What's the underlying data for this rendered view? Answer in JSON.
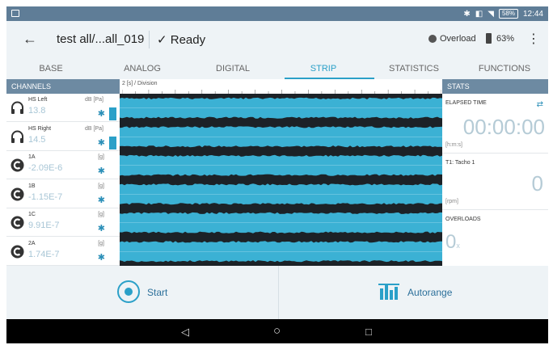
{
  "status_bar": {
    "battery_badge": "58%",
    "time": "12:44",
    "bluetooth_icon": "bluetooth-icon",
    "vibrate_icon": "vibrate-icon",
    "wifi_icon": "wifi-icon"
  },
  "app_bar": {
    "back_icon": "arrow-left-icon",
    "title": "test all/...all_019",
    "status_check": "✓",
    "status": "Ready",
    "overload_label": "Overload",
    "battery_pct": "63%",
    "menu_icon": "more-vert-icon"
  },
  "tabs": [
    {
      "label": "BASE"
    },
    {
      "label": "ANALOG"
    },
    {
      "label": "DIGITAL"
    },
    {
      "label": "STRIP"
    },
    {
      "label": "STATISTICS"
    },
    {
      "label": "FUNCTIONS"
    }
  ],
  "active_tab": "STRIP",
  "channels": {
    "header": "CHANNELS",
    "items": [
      {
        "name": "HS Left",
        "value": "13.8",
        "unit": "dB [Pa]",
        "icon": "headphones-icon",
        "has_bar": true
      },
      {
        "name": "HS Right",
        "value": "14.5",
        "unit": "dB [Pa]",
        "icon": "headphones-icon",
        "has_bar": true
      },
      {
        "name": "1A",
        "value": "-2.09E-6",
        "unit": "[g]",
        "icon": "sensor-c-icon",
        "has_bar": false
      },
      {
        "name": "1B",
        "value": "-1.15E-7",
        "unit": "[g]",
        "icon": "sensor-c-icon",
        "has_bar": false
      },
      {
        "name": "1C",
        "value": "9.91E-7",
        "unit": "[g]",
        "icon": "sensor-c-icon",
        "has_bar": false
      },
      {
        "name": "2A",
        "value": "1.74E-7",
        "unit": "[g]",
        "icon": "sensor-c-icon",
        "has_bar": false
      }
    ]
  },
  "strip": {
    "division_label": "2 [s] / Division",
    "lane_color": "#3bb1d4",
    "background_color": "#1c2227"
  },
  "stats": {
    "header": "STATS",
    "elapsed": {
      "label": "ELAPSED TIME",
      "value": "00:00:00",
      "unit": "[h:m:s]"
    },
    "tacho": {
      "label": "T1: Tacho 1",
      "value": "0",
      "unit": "[rpm]"
    },
    "overloads": {
      "label": "OVERLOADS",
      "value": "0",
      "subscript": "x"
    }
  },
  "actions": {
    "start_label": "Start",
    "autorange_label": "Autorange",
    "start_icon": "record-icon",
    "autorange_icon": "autorange-bars-icon"
  },
  "nav": {
    "back": "◁",
    "home": "○",
    "recents": "□"
  },
  "colors": {
    "accent": "#2ba0c8",
    "header_bg": "#6d8aa2",
    "statusbar_bg": "#5f7d97"
  }
}
